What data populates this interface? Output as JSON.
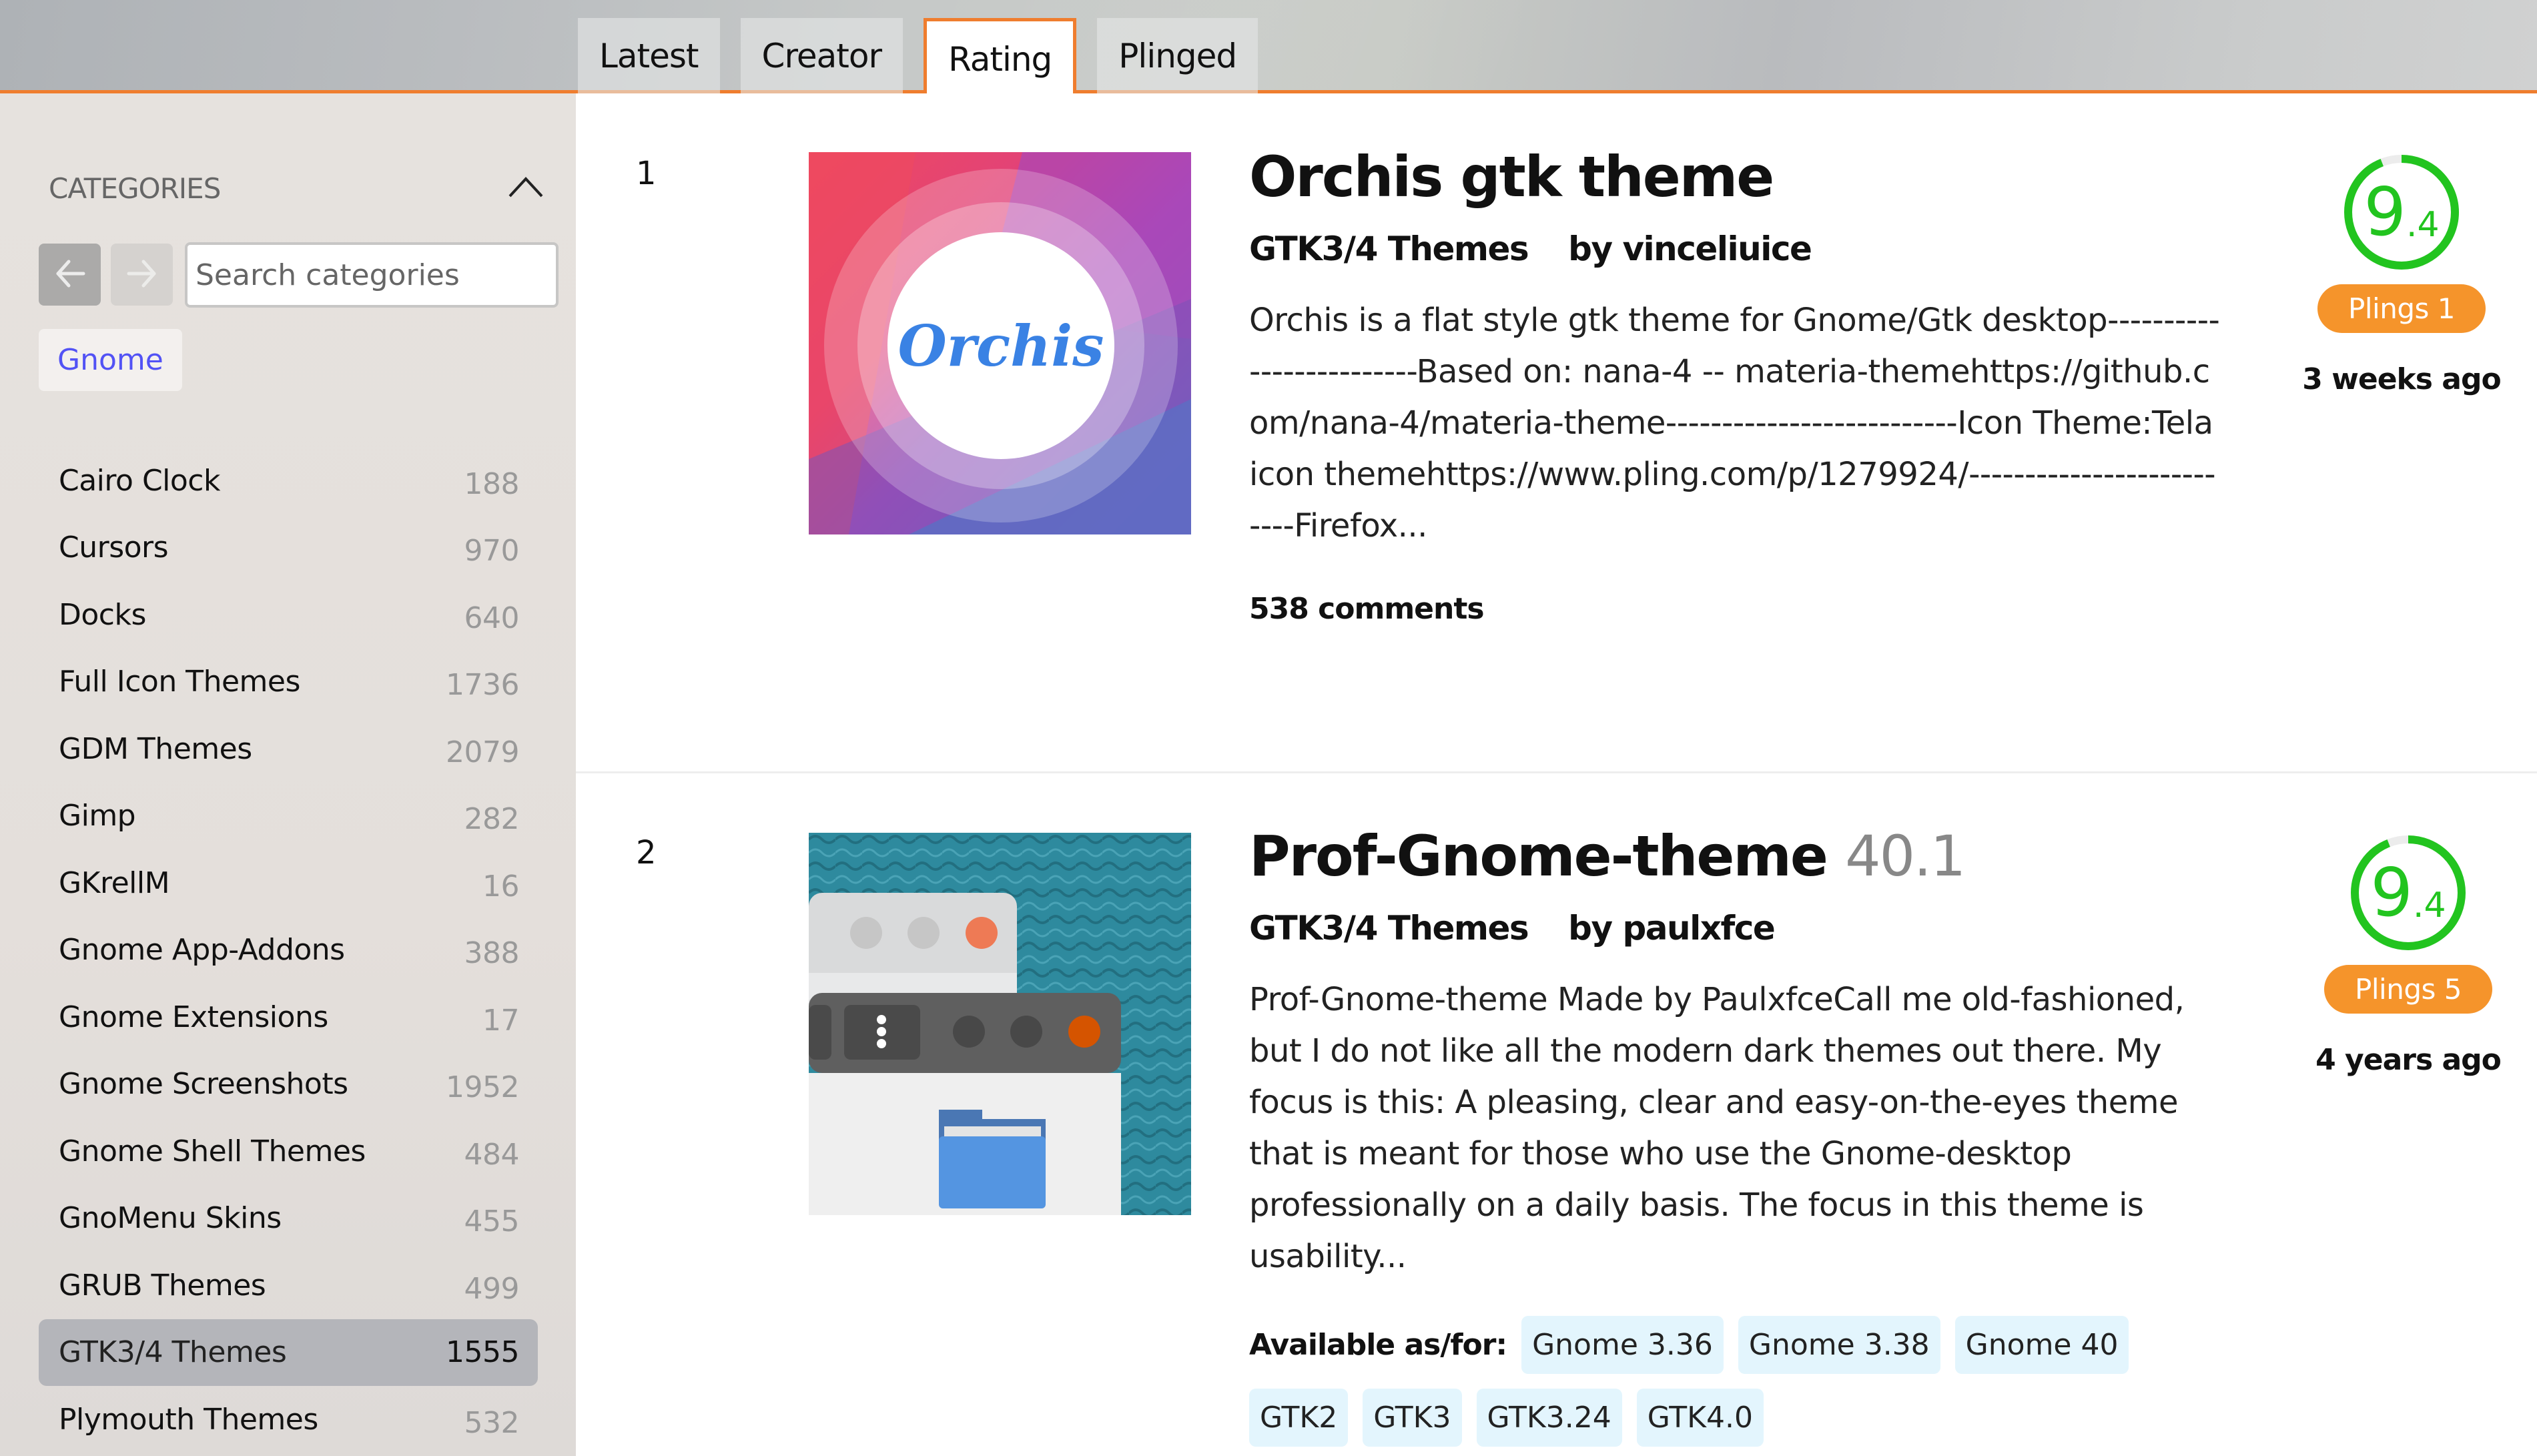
{
  "header": {
    "tabs": [
      {
        "label": "Latest",
        "active": false
      },
      {
        "label": "Creator",
        "active": false
      },
      {
        "label": "Rating",
        "active": true
      },
      {
        "label": "Plinged",
        "active": false
      }
    ],
    "accent_color": "#ef7d2e"
  },
  "sidebar": {
    "heading": "CATEGORIES",
    "toggle_icon": "chevron-up-icon",
    "back_icon": "arrow-left-icon",
    "forward_icon": "arrow-right-icon",
    "search_placeholder": "Search categories",
    "search_value": "",
    "parent_chip": "Gnome",
    "categories": [
      {
        "name": "Cairo Clock",
        "count": "188"
      },
      {
        "name": "Cursors",
        "count": "970"
      },
      {
        "name": "Docks",
        "count": "640"
      },
      {
        "name": "Full Icon Themes",
        "count": "1736"
      },
      {
        "name": "GDM Themes",
        "count": "2079"
      },
      {
        "name": "Gimp",
        "count": "282"
      },
      {
        "name": "GKrellM",
        "count": "16"
      },
      {
        "name": "Gnome App-Addons",
        "count": "388"
      },
      {
        "name": "Gnome Extensions",
        "count": "17"
      },
      {
        "name": "Gnome Screenshots",
        "count": "1952"
      },
      {
        "name": "Gnome Shell Themes",
        "count": "484"
      },
      {
        "name": "GnoMenu Skins",
        "count": "455"
      },
      {
        "name": "GRUB Themes",
        "count": "499"
      },
      {
        "name": "GTK3/4 Themes",
        "count": "1555",
        "active": true
      },
      {
        "name": "Plymouth Themes",
        "count": "532"
      }
    ]
  },
  "items": [
    {
      "rank": "1",
      "title": "Orchis gtk theme",
      "version": "",
      "category": "GTK3/4 Themes",
      "author": "by vinceliuice",
      "thumbnail_text": "Orchis",
      "description": "Orchis is a flat style gtk theme for Gnome/Gtk desktop-------------------------Based on: nana-4 -- materia-themehttps://github.com/nana-4/materia-theme--------------------------Icon Theme:Tela icon themehttps://www.pling.com/p/1279924/--------------------------Firefox...",
      "comments": "538 comments",
      "score_int": "9",
      "score_dec": ".4",
      "score": 9.4,
      "plings": "Plings 1",
      "ago": "3 weeks ago"
    },
    {
      "rank": "2",
      "title": "Prof-Gnome-theme",
      "version": "40.1",
      "category": "GTK3/4 Themes",
      "author": "by paulxfce",
      "description": "Prof-Gnome-theme Made by PaulxfceCall me old-fashioned, but I do not like all the modern dark themes out there. My focus is this: A pleasing, clear and easy-on-the-eyes theme that is meant for those who use the Gnome-desktop professionally on a daily basis. The focus in this theme is usability...",
      "available_label": "Available as/for:",
      "tags": [
        "Gnome 3.36",
        "Gnome 3.38",
        "Gnome 40",
        "GTK2",
        "GTK3",
        "GTK3.24",
        "GTK4.0"
      ],
      "score_int": "9",
      "score_dec": ".4",
      "score": 9.4,
      "plings": "Plings 5",
      "ago": "4 years ago"
    }
  ],
  "colors": {
    "score_green": "#22c41f",
    "plings_orange": "#f5942b",
    "chip_blue": "#5252f5",
    "tag_bg": "#e3f5fd"
  }
}
